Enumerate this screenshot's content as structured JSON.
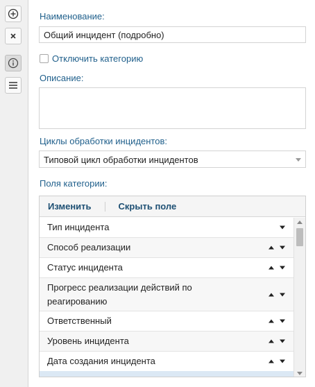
{
  "toolbar": {
    "buttons": [
      {
        "icon": "add-circle-icon"
      },
      {
        "icon": "close-icon"
      },
      {
        "icon": "info-icon",
        "active": true
      },
      {
        "icon": "menu-icon"
      }
    ]
  },
  "form": {
    "name_label": "Наименование:",
    "name_value": "Общий инцидент (подробно)",
    "disable_category_label": "Отключить категорию",
    "disable_category_checked": false,
    "description_label": "Описание:",
    "description_value": "",
    "cycles_label": "Циклы обработки инцидентов:",
    "cycles_value": "Типовой цикл обработки инцидентов",
    "fields_label": "Поля категории:"
  },
  "grid": {
    "edit_label": "Изменить",
    "hide_label": "Скрыть поле",
    "rows": [
      {
        "label": "Тип инцидента",
        "up": false,
        "down": true
      },
      {
        "label": "Способ реализации",
        "up": true,
        "down": true
      },
      {
        "label": "Статус инцидента",
        "up": true,
        "down": true
      },
      {
        "label": "Прогресс реализации действий по реагированию",
        "up": true,
        "down": true
      },
      {
        "label": "Ответственный",
        "up": true,
        "down": true
      },
      {
        "label": "Уровень инцидента",
        "up": true,
        "down": true
      },
      {
        "label": "Дата создания инцидента",
        "up": true,
        "down": true
      }
    ]
  },
  "colors": {
    "label": "#1f5f8b",
    "grid_button": "#1d4f73",
    "selected_row": "#dbe8f4"
  }
}
